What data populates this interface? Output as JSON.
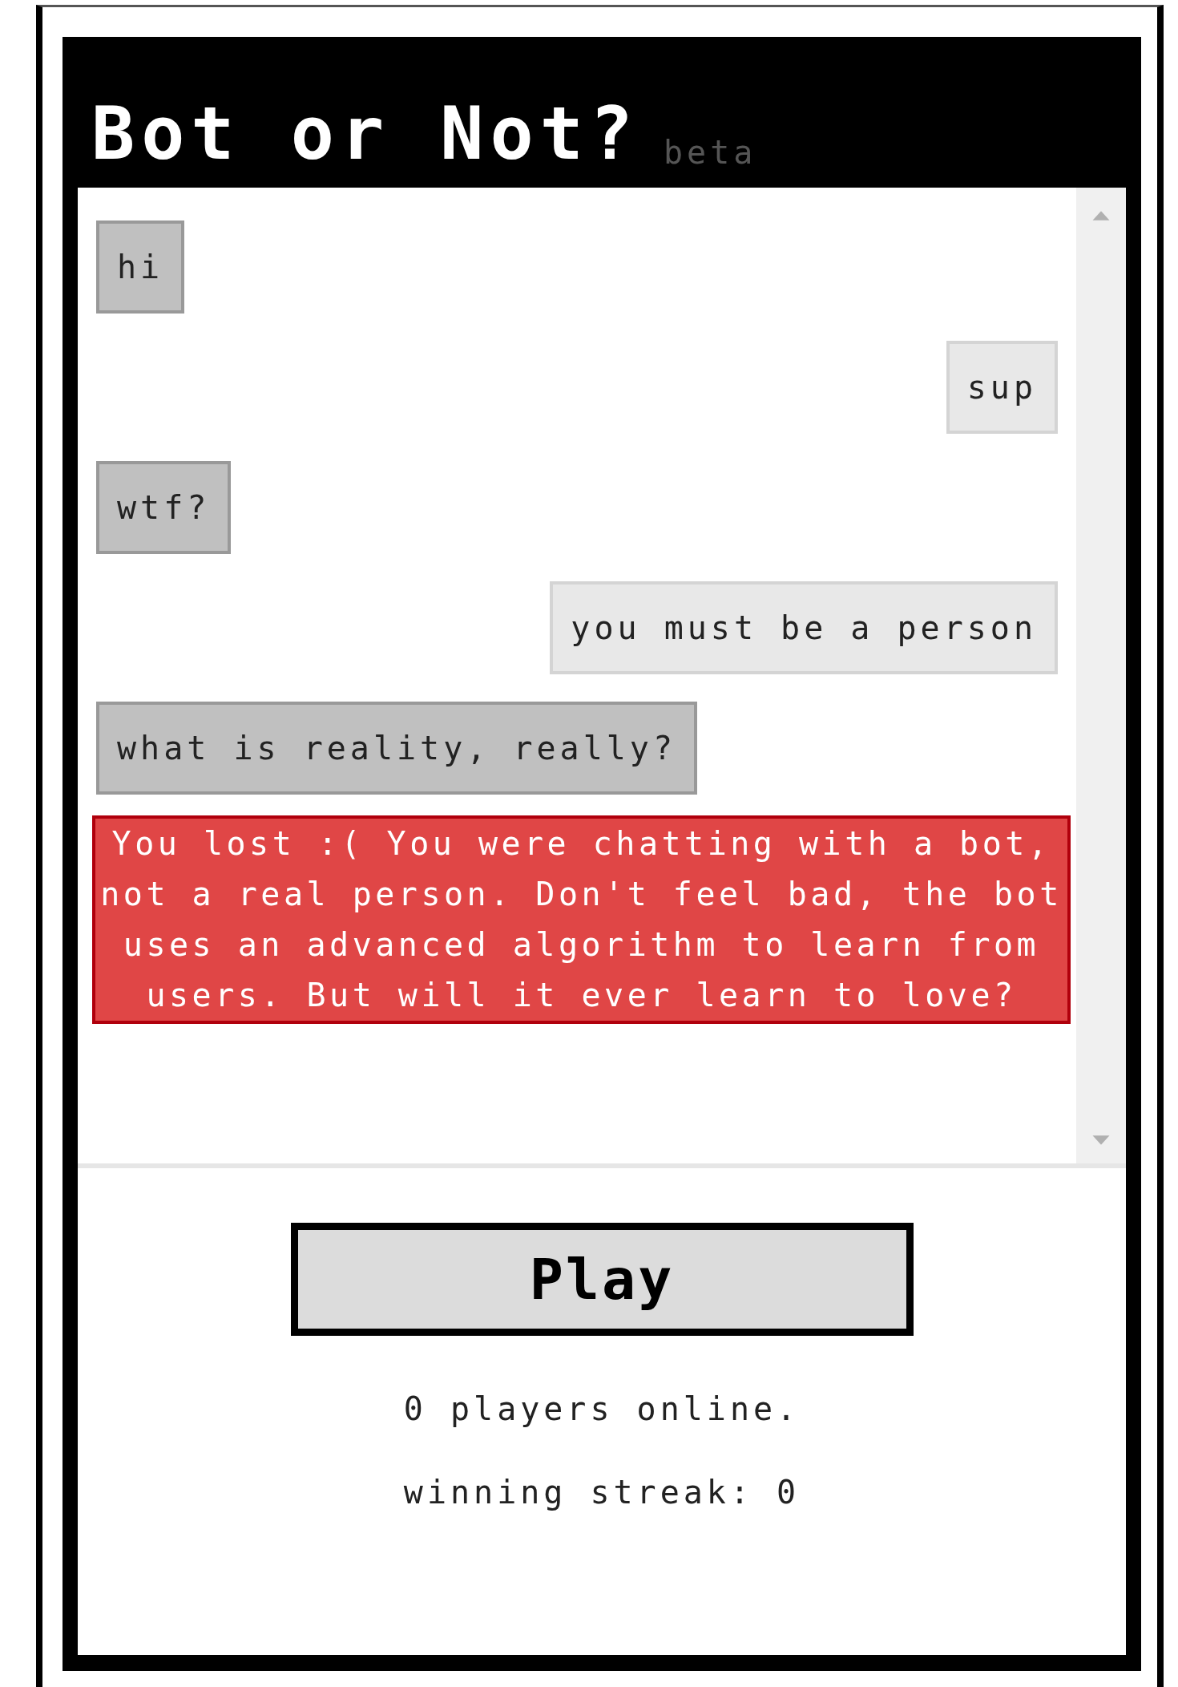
{
  "header": {
    "title": "Bot or Not?",
    "badge": "beta"
  },
  "messages": [
    {
      "text": "hi",
      "kind": "received"
    },
    {
      "text": "sup",
      "kind": "sent"
    },
    {
      "text": "wtf?",
      "kind": "received"
    },
    {
      "text": "you must be a person",
      "kind": "sent"
    },
    {
      "text": "what is reality, really?",
      "kind": "received"
    }
  ],
  "result": {
    "text": "You lost :( You were chatting with a bot, not a real person. Don't feel bad, the bot uses an advanced algorithm to learn from users. But will it ever learn to love?"
  },
  "play_button": {
    "label": "Play"
  },
  "players_online": "0 players online.",
  "winning_streak": "winning streak: 0"
}
